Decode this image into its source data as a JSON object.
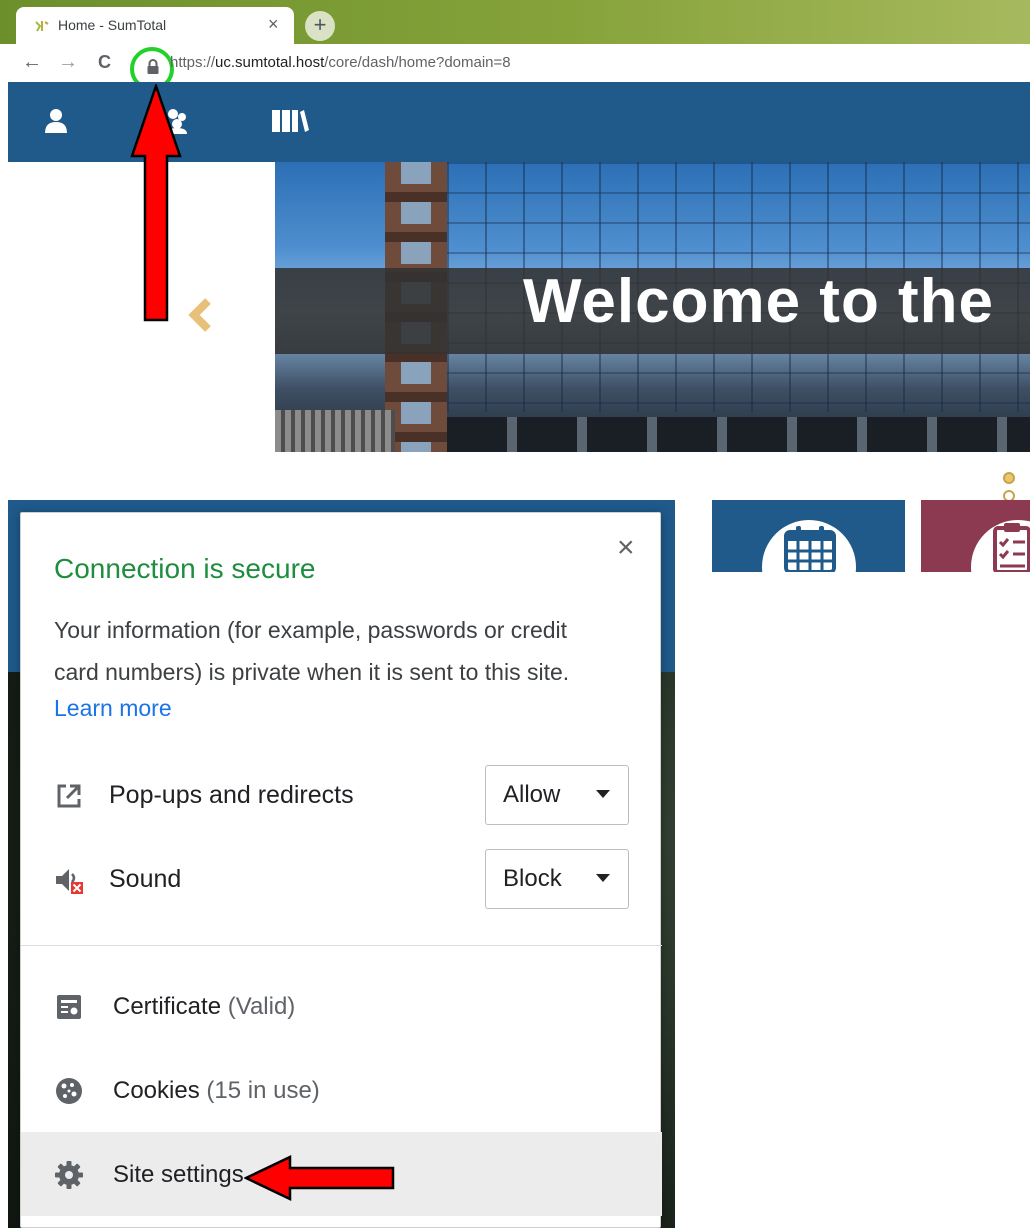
{
  "browser": {
    "tab_title": "Home - SumTotal",
    "tab_close": "×",
    "new_tab": "+",
    "back": "←",
    "forward": "→",
    "reload": "C",
    "url_prefix": "https://",
    "url_host": "uc.sumtotal.host",
    "url_path": "/core/dash/home?domain=8"
  },
  "banner": {
    "headline": "Welcome to the"
  },
  "popup": {
    "close": "×",
    "title": "Connection is secure",
    "description": "Your information (for example, passwords or credit card numbers) is private when it is sent to this site.",
    "learn_more": "Learn more",
    "permissions": [
      {
        "label": "Pop-ups and redirects",
        "value": "Allow",
        "icon": "external-link-icon"
      },
      {
        "label": "Sound",
        "value": "Block",
        "icon": "speaker-muted-icon"
      }
    ],
    "items": [
      {
        "label": "Certificate",
        "detail": "(Valid)",
        "icon": "certificate-icon"
      },
      {
        "label": "Cookies",
        "detail": "(15 in use)",
        "icon": "cookie-icon"
      },
      {
        "label": "Site settings",
        "detail": "",
        "icon": "gear-icon"
      }
    ]
  },
  "colors": {
    "brand_blue": "#1f5a8b",
    "secure_green": "#1e8e3e",
    "link_blue": "#1a73e8",
    "annotation_red": "#ff0000",
    "highlight_ring": "#22d12a"
  }
}
